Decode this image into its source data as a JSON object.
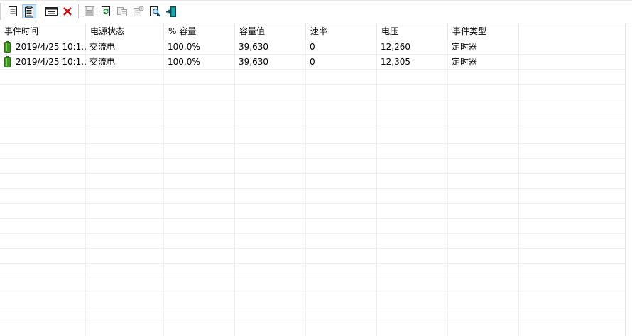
{
  "toolbar": {
    "buttons": [
      {
        "name": "details-button",
        "icon": "document-icon",
        "enabled": true,
        "pressed": false
      },
      {
        "name": "list-button",
        "icon": "clipboard-icon",
        "enabled": true,
        "pressed": true
      },
      {
        "name": "window-button",
        "icon": "window-icon",
        "enabled": true,
        "pressed": false
      },
      {
        "name": "delete-button",
        "icon": "red-x-icon",
        "enabled": true,
        "pressed": false
      },
      {
        "name": "save-button",
        "icon": "floppy-disk-icon",
        "enabled": false,
        "pressed": false
      },
      {
        "name": "refresh-button",
        "icon": "refresh-icon",
        "enabled": true,
        "pressed": false
      },
      {
        "name": "copy-button",
        "icon": "copy-icon",
        "enabled": false,
        "pressed": false
      },
      {
        "name": "properties-button",
        "icon": "properties-icon",
        "enabled": false,
        "pressed": false
      },
      {
        "name": "find-button",
        "icon": "magnifier-icon",
        "enabled": true,
        "pressed": false
      },
      {
        "name": "exit-button",
        "icon": "exit-door-icon",
        "enabled": true,
        "pressed": false
      }
    ],
    "colors": {
      "accent": "#0078d7",
      "red": "#d40000",
      "teal": "#008080",
      "disabled": "#a0a0a0"
    }
  },
  "table": {
    "columns": [
      "事件时间",
      "电源状态",
      "% 容量",
      "容量值",
      "速率",
      "电压",
      "事件类型"
    ],
    "rows": [
      {
        "icon": "battery-icon",
        "cells": [
          "2019/4/25 10:1...",
          "交流电",
          "100.0%",
          "39,630",
          "0",
          "12,260",
          "定时器"
        ]
      },
      {
        "icon": "battery-icon",
        "cells": [
          "2019/4/25 10:1...",
          "交流电",
          "100.0%",
          "39,630",
          "0",
          "12,305",
          "定时器"
        ]
      }
    ],
    "battery_color": "#3a9a1e"
  }
}
